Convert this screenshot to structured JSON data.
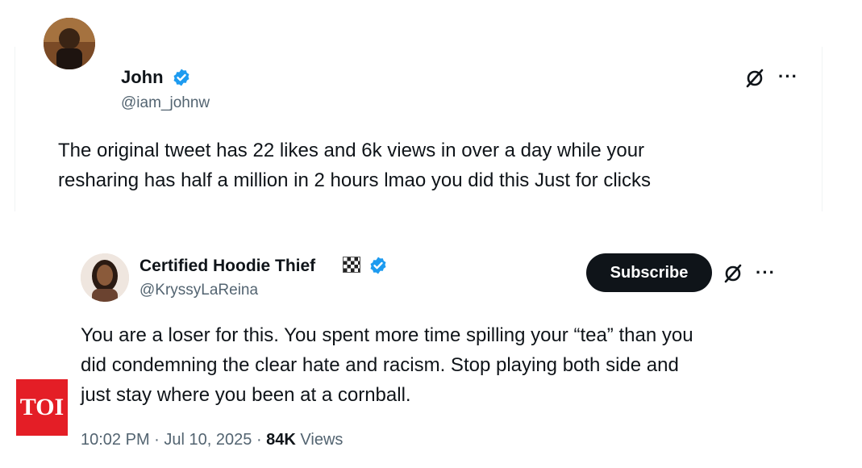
{
  "tweet1": {
    "name": "John",
    "handle": "@iam_johnw",
    "text": "The original tweet has 22 likes and  6k views in over a day  while your resharing has half a million in 2 hours lmao you did this Just for clicks",
    "line1": "The original tweet has 22 likes and  6k views in over a day  while your",
    "line2": "resharing has half a million in 2 hours lmao you did this Just for clicks",
    "icons": [
      "avatar",
      "verified-badge-icon",
      "grok-icon",
      "more-icon"
    ]
  },
  "tweet2": {
    "name": "Certified Hoodie Thief",
    "handle": "@KryssyLaReina",
    "subscribe_label": "Subscribe",
    "line1": "You are a loser for this.  You  spent more time spilling your “tea” than you",
    "line2": "did condemning the clear hate and racism.  Stop playing both side and",
    "line3": "just stay where you been at a cornball.",
    "time": "10:02 PM",
    "date": "Jul 10, 2025",
    "views_count": "84K",
    "views_label": "Views",
    "icons": [
      "avatar",
      "checkered-flag-icon",
      "verified-badge-icon",
      "grok-icon",
      "more-icon"
    ]
  },
  "watermark": {
    "label": "TOI"
  },
  "colors": {
    "verified": "#1d9bf0",
    "text": "#0f1419",
    "secondary": "#536471",
    "toi_red": "#e41e26"
  }
}
